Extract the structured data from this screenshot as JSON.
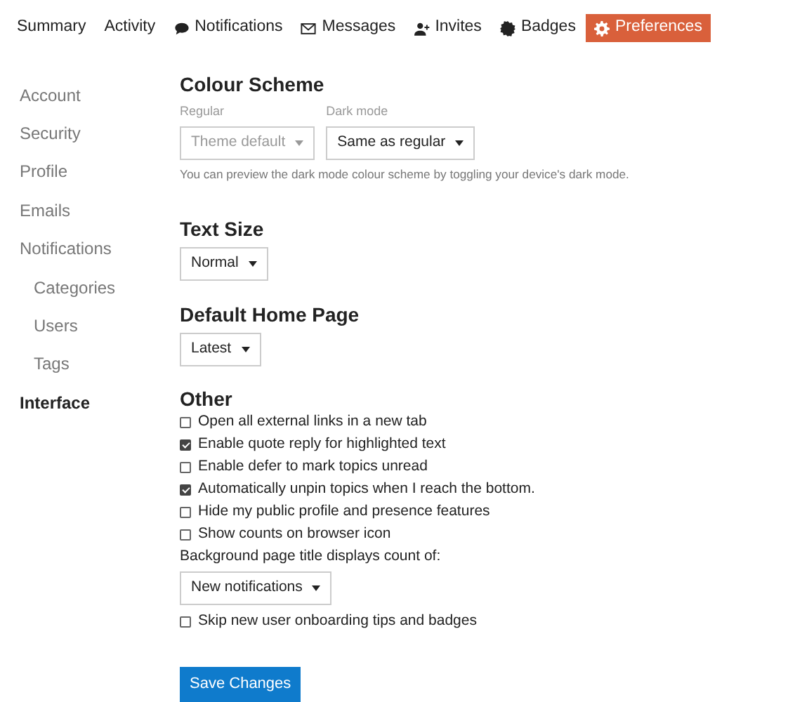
{
  "tabs": [
    {
      "label": "Summary",
      "kind": "plain",
      "selected": false
    },
    {
      "label": "Activity",
      "kind": "plain",
      "selected": false
    },
    {
      "label": "Notifications",
      "kind": "bubble",
      "selected": false
    },
    {
      "label": "Messages",
      "kind": "envelope",
      "selected": false
    },
    {
      "label": "Invites",
      "kind": "person",
      "selected": false
    },
    {
      "label": "Badges",
      "kind": "badge",
      "selected": false
    },
    {
      "label": "Preferences",
      "kind": "gear",
      "selected": true
    }
  ],
  "sidebar": {
    "items": [
      {
        "label": "Account",
        "selected": false
      },
      {
        "label": "Security",
        "selected": false
      },
      {
        "label": "Profile",
        "selected": false
      },
      {
        "label": "Emails",
        "selected": false
      },
      {
        "label": "Notifications",
        "selected": false,
        "children": [
          {
            "label": "Categories",
            "selected": false
          },
          {
            "label": "Users",
            "selected": false
          },
          {
            "label": "Tags",
            "selected": false
          }
        ]
      },
      {
        "label": "Interface",
        "selected": true
      }
    ]
  },
  "colour_scheme": {
    "title": "Colour Scheme",
    "selects": [
      {
        "label": "Regular",
        "value": "Theme default",
        "disabled": true
      },
      {
        "label": "Dark mode",
        "value": "Same as regular",
        "disabled": false
      }
    ],
    "help": "You can preview the dark mode colour scheme by toggling your device's dark mode."
  },
  "text_size": {
    "title": "Text Size",
    "value": "Normal"
  },
  "default_home_page": {
    "title": "Default Home Page",
    "value": "Latest"
  },
  "other": {
    "title": "Other",
    "items": [
      {
        "kind": "checkbox",
        "label": "Open all external links in a new tab",
        "checked": false
      },
      {
        "kind": "checkbox",
        "label": "Enable quote reply for highlighted text",
        "checked": true
      },
      {
        "kind": "checkbox",
        "label": "Enable defer to mark topics unread",
        "checked": false
      },
      {
        "kind": "checkbox",
        "label": "Automatically unpin topics when I reach the bottom.",
        "checked": true
      },
      {
        "kind": "checkbox",
        "label": "Hide my public profile and presence features",
        "checked": false
      },
      {
        "kind": "checkbox",
        "label": "Show counts on browser icon",
        "checked": false
      },
      {
        "kind": "select",
        "label": "Background page title displays count of:",
        "value": "New notifications"
      },
      {
        "kind": "checkbox",
        "label": "Skip new user onboarding tips and badges",
        "checked": false
      }
    ]
  },
  "save_button": "Save Changes"
}
